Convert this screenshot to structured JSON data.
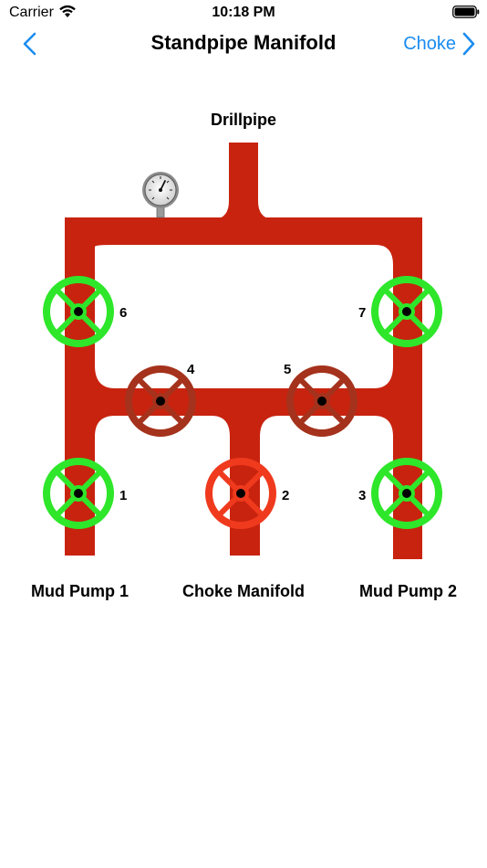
{
  "status_bar": {
    "carrier": "Carrier",
    "time": "10:18 PM",
    "icons": [
      "wifi-icon",
      "battery-icon"
    ]
  },
  "nav": {
    "title": "Standpipe Manifold",
    "back_icon": "chevron-left-icon",
    "forward_label": "Choke",
    "forward_icon": "chevron-right-icon",
    "accent_color": "#1a8cf0"
  },
  "diagram": {
    "top_label": "Drillpipe",
    "bottom_labels": {
      "left": "Mud Pump 1",
      "center": "Choke Manifold",
      "right": "Mud Pump 2"
    },
    "gauge_icon": "pressure-gauge-icon",
    "pipe_color": "#c8230f",
    "colors": {
      "open": "#2ee62a",
      "closed": "#a5321c",
      "highlight_closed": "#ef3a1e"
    },
    "valves": [
      {
        "number": "1",
        "state": "open"
      },
      {
        "number": "2",
        "state": "highlight_closed"
      },
      {
        "number": "3",
        "state": "open"
      },
      {
        "number": "4",
        "state": "closed"
      },
      {
        "number": "5",
        "state": "closed"
      },
      {
        "number": "6",
        "state": "open"
      },
      {
        "number": "7",
        "state": "open"
      }
    ]
  }
}
